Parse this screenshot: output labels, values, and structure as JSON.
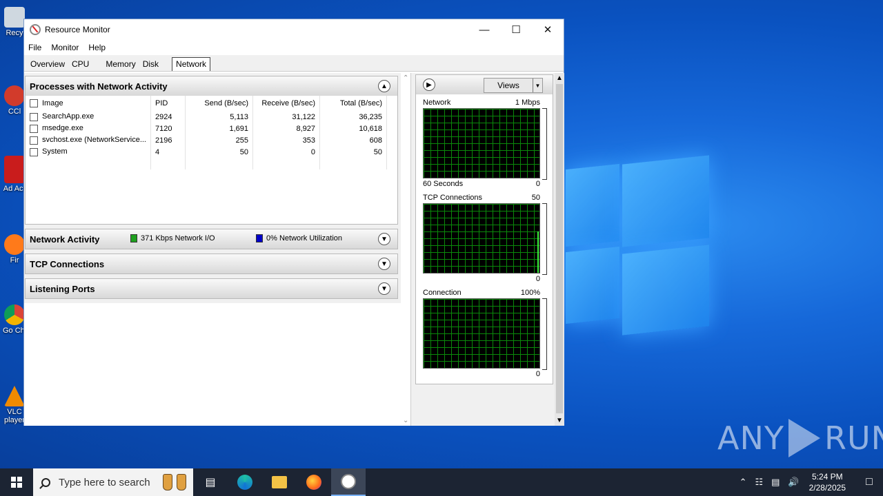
{
  "window": {
    "title": "Resource Monitor",
    "menu": [
      "File",
      "Monitor",
      "Help"
    ],
    "tabs": [
      "Overview",
      "CPU",
      "Memory",
      "Disk",
      "Network"
    ],
    "active_tab": "Network"
  },
  "processes": {
    "title": "Processes with Network Activity",
    "columns": [
      "Image",
      "PID",
      "Send (B/sec)",
      "Receive (B/sec)",
      "Total (B/sec)"
    ],
    "rows": [
      {
        "image": "SearchApp.exe",
        "pid": "2924",
        "send": "5,113",
        "receive": "31,122",
        "total": "36,235"
      },
      {
        "image": "msedge.exe",
        "pid": "7120",
        "send": "1,691",
        "receive": "8,927",
        "total": "10,618"
      },
      {
        "image": "svchost.exe (NetworkService...",
        "pid": "2196",
        "send": "255",
        "receive": "353",
        "total": "608"
      },
      {
        "image": "System",
        "pid": "4",
        "send": "50",
        "receive": "0",
        "total": "50"
      }
    ]
  },
  "network_activity": {
    "title": "Network Activity",
    "io_legend": "371 Kbps Network I/O",
    "util_legend": "0% Network Utilization",
    "io_color": "#1fa01f",
    "util_color": "#0000c8"
  },
  "tcp": {
    "title": "TCP Connections"
  },
  "listening": {
    "title": "Listening Ports"
  },
  "right_pane": {
    "views_label": "Views",
    "graphs": [
      {
        "title": "Network",
        "max": "1 Mbps",
        "left_footer": "60 Seconds",
        "min": "0",
        "level": 0
      },
      {
        "title": "TCP Connections",
        "max": "50",
        "left_footer": "",
        "min": "0",
        "level": 0.6
      },
      {
        "title": "Connection",
        "max": "100%",
        "left_footer": "",
        "min": "0",
        "level": 0
      }
    ]
  },
  "desktop": {
    "icons": [
      "Recy",
      "CCl",
      "Ad Acr",
      "Fir",
      "Go Chr",
      "VLC player"
    ],
    "watermark": "ANY RUN"
  },
  "taskbar": {
    "search_placeholder": "Type here to search",
    "time": "5:24 PM",
    "date": "2/28/2025"
  }
}
